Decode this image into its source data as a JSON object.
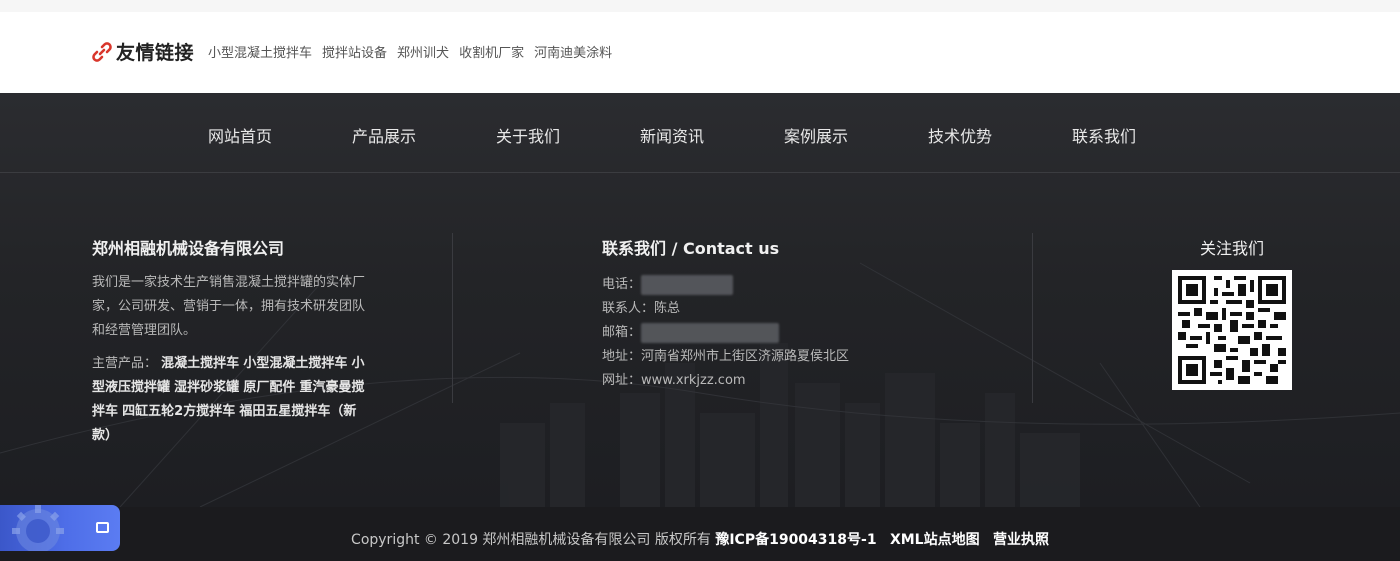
{
  "friend_links": {
    "title": "友情链接",
    "items": [
      "小型混凝土搅拌车",
      "搅拌站设备",
      "郑州训犬",
      "收割机厂家",
      "河南迪美涂料"
    ]
  },
  "nav": {
    "items": [
      "网站首页",
      "产品展示",
      "关于我们",
      "新闻资讯",
      "案例展示",
      "技术优势",
      "联系我们"
    ]
  },
  "company": {
    "title": "郑州相融机械设备有限公司",
    "description": "我们是一家技术生产销售混凝土搅拌罐的实体厂家，公司研发、营销于一体，拥有技术研发团队和经营管理团队。",
    "products_label": "主营产品：",
    "products": [
      "混凝土搅拌车",
      "小型混凝土搅拌车",
      "小型液压搅拌罐",
      "湿拌砂浆罐",
      "原厂配件",
      "重汽豪曼搅拌车",
      "四缸五轮2方搅拌车",
      "福田五星搅拌车（新款）"
    ]
  },
  "contact": {
    "title": "联系我们 / Contact us",
    "phone_label": "电话：",
    "person_label": "联系人：",
    "person": "陈总",
    "email_label": "邮箱：",
    "address_label": "地址：",
    "address": "河南省郑州市上街区济源路夏侯北区",
    "website_label": "网址：",
    "website": "www.xrkjzz.com"
  },
  "follow": {
    "title": "关注我们",
    "qr_icon": "qr-code"
  },
  "footer": {
    "copyright": "Copyright © 2019 郑州相融机械设备有限公司 版权所有",
    "icp": "豫ICP备19004318号-1",
    "sitemap": "XML站点地图",
    "license": "营业执照"
  },
  "colors": {
    "accent_red": "#d9362b",
    "footer_bg": "#232427",
    "widget_blue": "#4e6ee8"
  }
}
